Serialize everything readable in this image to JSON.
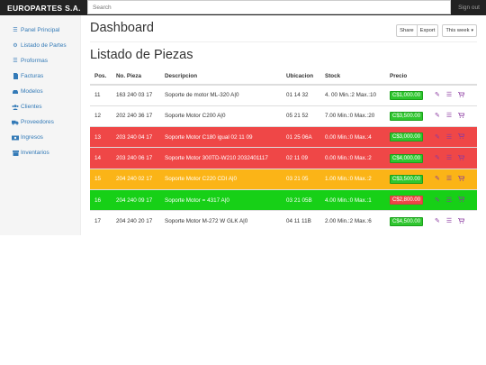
{
  "topbar": {
    "brand": "EUROPARTES S.A.",
    "search_placeholder": "Search",
    "signout": "Sign out"
  },
  "sidebar": {
    "items": [
      {
        "label": "Panel Principal",
        "icon": "list-icon"
      },
      {
        "label": "Listado de Partes",
        "icon": "cogs-icon"
      },
      {
        "label": "Proformas",
        "icon": "list-icon"
      },
      {
        "label": "Facturas",
        "icon": "file-icon"
      },
      {
        "label": "Modelos",
        "icon": "car-icon"
      },
      {
        "label": "Clientes",
        "icon": "users-icon"
      },
      {
        "label": "Proveedores",
        "icon": "truck-icon"
      },
      {
        "label": "Ingresos",
        "icon": "money-icon"
      },
      {
        "label": "Inventarios",
        "icon": "archive-icon"
      }
    ]
  },
  "header": {
    "title": "Dashboard",
    "share": "Share",
    "export": "Export",
    "period": "This week"
  },
  "section": {
    "title": "Listado de Piezas"
  },
  "table": {
    "columns": [
      "Pos.",
      "No. Pieza",
      "Descripcion",
      "Ubicacion",
      "Stock",
      "Precio"
    ],
    "rows": [
      {
        "pos": "11",
        "no_pieza": "163 240 03 17",
        "descripcion": "Soporte de motor ML-320 A|0",
        "ubicacion": "01 14 32",
        "stock": "4. 00 Min.:2 Max.:10",
        "precio": "C$1,000.00",
        "status": "normal"
      },
      {
        "pos": "12",
        "no_pieza": "202 240 36 17",
        "descripcion": "Soporte Motor C200 A|0",
        "ubicacion": "05 21 52",
        "stock": "7.00 Min.:0 Max.:20",
        "precio": "C$3,500.00",
        "status": "normal"
      },
      {
        "pos": "13",
        "no_pieza": "203 240 04 17",
        "descripcion": "Soporte Motor C180 igual 02 11 09",
        "ubicacion": "01 25 06A",
        "stock": "0.00 Min.:0 Max.:4",
        "precio": "C$3,000.00",
        "status": "red"
      },
      {
        "pos": "14",
        "no_pieza": "203 240 06 17",
        "descripcion": "Soporte Motor 300TD-W210 2032401117",
        "ubicacion": "02 11 09",
        "stock": "0.00 Min.:0 Max.:2",
        "precio": "C$4,000.00",
        "status": "red"
      },
      {
        "pos": "15",
        "no_pieza": "204 240 02 17",
        "descripcion": "Soporte Motor C220 CDI A|0",
        "ubicacion": "03 21 05",
        "stock": "1.00 Min.:0 Max.:2",
        "precio": "C$3,500.00",
        "status": "orange"
      },
      {
        "pos": "16",
        "no_pieza": "204 240 09 17",
        "descripcion": "Soporte Motor = 4317 A|0",
        "ubicacion": "03 21 05B",
        "stock": "4.00 Min.:0 Max.:1",
        "precio": "C$2,800.00",
        "status": "green"
      },
      {
        "pos": "17",
        "no_pieza": "204 240 20 17",
        "descripcion": "Soporte Motor M-272 W GLK A|0",
        "ubicacion": "04 11 11B",
        "stock": "2.00 Min.:2 Max.:6",
        "precio": "C$4,500.00",
        "status": "normal"
      }
    ]
  },
  "colors": {
    "red": "#ef4747",
    "orange": "#fbb417",
    "green": "#17d017",
    "price_badge": "#2fc62f",
    "action_icon": "#8b3aa0"
  },
  "row_actions": [
    "pencil-icon",
    "list-icon",
    "cart-icon"
  ]
}
